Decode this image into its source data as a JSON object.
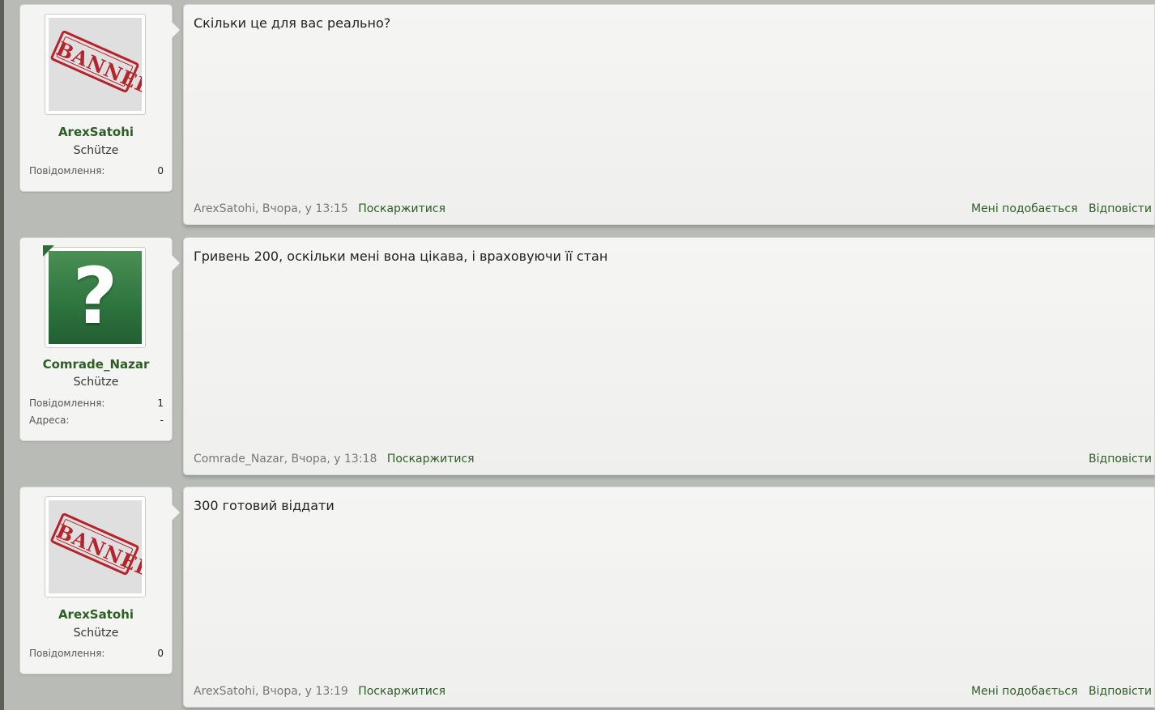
{
  "posts": [
    {
      "user": {
        "avatar_icon": "banned-stamp-icon",
        "avatar_text": "BANNED",
        "username": "ArexSatohi",
        "rank": "Schütze",
        "stats": [
          {
            "label": "Повідомлення:",
            "value": "0"
          }
        ]
      },
      "message": "Скільки це для вас реально?",
      "author": "ArexSatohi",
      "date": "Вчора, у 13:15",
      "report": "Поскаржитися",
      "like": "Мені подобається",
      "reply": "Відповісти"
    },
    {
      "user": {
        "avatar_icon": "question-mark-icon",
        "avatar_text": "?",
        "username": "Comrade_Nazar",
        "rank": "Schütze",
        "stats": [
          {
            "label": "Повідомлення:",
            "value": "1"
          },
          {
            "label": "Адреса:",
            "value": "-"
          }
        ]
      },
      "message": "Гривень 200, оскільки мені вона цікава, і враховуючи її стан",
      "author": "Comrade_Nazar",
      "date": "Вчора, у 13:18",
      "report": "Поскаржитися",
      "reply": "Відповісти"
    },
    {
      "user": {
        "avatar_icon": "banned-stamp-icon",
        "avatar_text": "BANNED",
        "username": "ArexSatohi",
        "rank": "Schütze",
        "stats": [
          {
            "label": "Повідомлення:",
            "value": "0"
          }
        ]
      },
      "message": "300 готовий віддати",
      "author": "ArexSatohi",
      "date": "Вчора, у 13:19",
      "report": "Поскаржитися",
      "like": "Мені подобається",
      "reply": "Відповісти"
    }
  ],
  "colors": {
    "accent": "#2e5d25",
    "banned": "#b5232b",
    "page_bg": "#b9bbb7"
  }
}
